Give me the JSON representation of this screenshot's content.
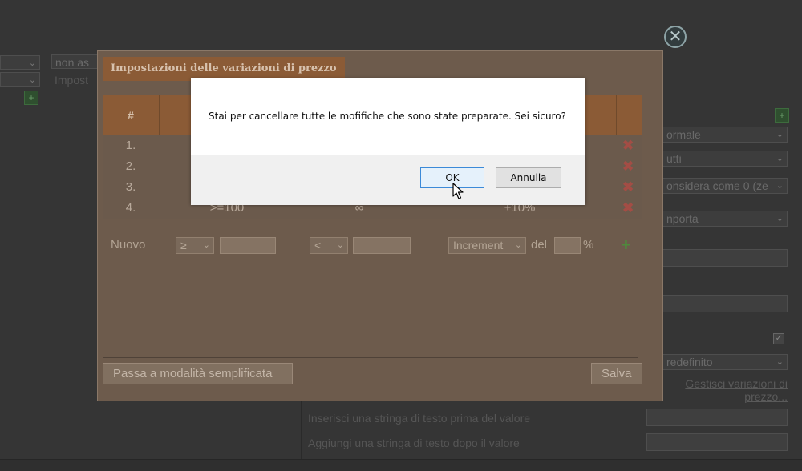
{
  "background": {
    "left_select_1": "",
    "left_select_2": "",
    "assign_select": "non as",
    "assign_text": "Impost",
    "right_selects": [
      "ormale",
      "utti",
      "onsidera come 0 (ze",
      "nporta",
      "redefinito"
    ],
    "manage_link": "Gestisci variazioni di prezzo...",
    "prefix_label": "Inserisci una stringa di testo prima del valore",
    "suffix_label": "Aggiungi una stringa di testo dopo il valore",
    "checkbox_checked": true
  },
  "price_dialog": {
    "title": "Impostazioni delle variazioni di prezzo",
    "header_hash": "#",
    "rows": [
      {
        "idx": "1.",
        "from": "",
        "to": "",
        "change": ""
      },
      {
        "idx": "2.",
        "from": "",
        "to": "",
        "change": ""
      },
      {
        "idx": "3.",
        "from": "",
        "to": "",
        "change": ""
      },
      {
        "idx": "4.",
        "from": ">=100",
        "to": "∞",
        "change": "+10%"
      }
    ],
    "new_label": "Nuovo",
    "op_from": "≥",
    "op_to": "<",
    "mode": "Increment",
    "del_label": "del",
    "percent": "%",
    "simplified_button": "Passa a modalità semplificata",
    "save_button": "Salva"
  },
  "confirm": {
    "message": "Stai per cancellare tutte le mofifiche che sono state preparate. Sei sicuro?",
    "ok": "OK",
    "cancel": "Annulla"
  },
  "icons": {
    "close": "close-circle-icon",
    "delete": "red-x-icon",
    "add": "green-plus-icon",
    "cursor": "mouse-pointer-icon"
  },
  "colors": {
    "dialog_title_bg": "#8b5b36",
    "ok_border": "#3c8ad8",
    "delete": "#a34d45",
    "add": "#4f8a3c"
  }
}
